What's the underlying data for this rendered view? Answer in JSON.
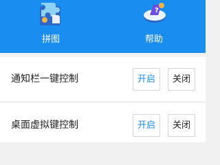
{
  "toolbar": {
    "tools": [
      {
        "label": "拼图",
        "icon": "puzzle-icon"
      },
      {
        "label": "帮助",
        "icon": "help-icon"
      }
    ]
  },
  "settings": [
    {
      "title": "通知栏一键控制",
      "on_label": "开启",
      "off_label": "关闭"
    },
    {
      "title": "桌面虚拟键控制",
      "on_label": "开启",
      "off_label": "关闭"
    }
  ],
  "colors": {
    "accent": "#1a8ef0",
    "background": "#f1f1f1",
    "card": "#ffffff"
  }
}
